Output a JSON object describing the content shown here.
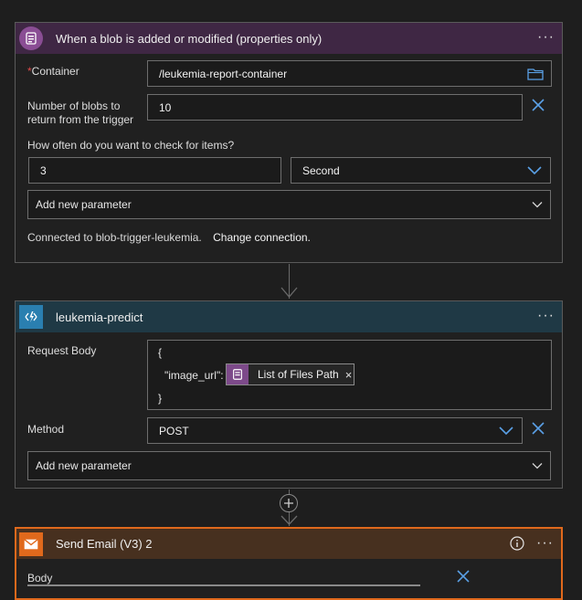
{
  "trigger": {
    "title": "When a blob is added or modified (properties only)",
    "container_label": "Container",
    "required_mark": "*",
    "container_value": "/leukemia-report-container",
    "blobs_label_line1": "Number of blobs to",
    "blobs_label_line2": "return from the trigger",
    "blobs_value": "10",
    "interval_label": "How often do you want to check for items?",
    "interval_value": "3",
    "frequency_value": "Second",
    "add_param_label": "Add new parameter",
    "connection_text": "Connected to blob-trigger-leukemia.",
    "change_connection_label": "Change connection.",
    "icon": "blob-storage-icon",
    "accent": "#4a2a4e"
  },
  "predict": {
    "title": "leukemia-predict",
    "request_body_label": "Request Body",
    "body_open": "{",
    "body_key": "\"image_url\":",
    "token_label": "List of Files Path",
    "body_close": "}",
    "method_label": "Method",
    "method_value": "POST",
    "add_param_label": "Add new parameter",
    "icon": "azure-function-icon",
    "accent": "#1d3a48"
  },
  "email": {
    "title": "Send Email (V3) 2",
    "body_label": "Body",
    "icon": "mail-icon",
    "accent": "#4a2e1e",
    "border": "#e0691c"
  },
  "menu_glyph": "···",
  "close_glyph": "×"
}
